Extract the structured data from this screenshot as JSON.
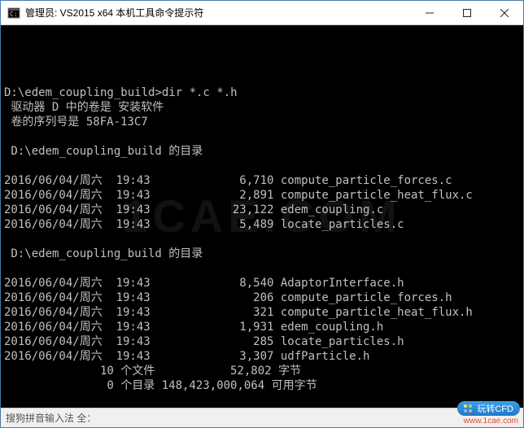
{
  "window": {
    "title": "管理员: VS2015 x64 本机工具命令提示符"
  },
  "terminal": {
    "prompt_path": "D:\\edem_coupling_build>",
    "command": "dir *.c *.h",
    "volume_line": " 驱动器 D 中的卷是 安装软件",
    "serial_line": " 卷的序列号是 58FA-13C7",
    "dir_header": " D:\\edem_coupling_build 的目录",
    "files_c": [
      {
        "date": "2016/06/04/周六",
        "time": "19:43",
        "size": "6,710",
        "name": "compute_particle_forces.c"
      },
      {
        "date": "2016/06/04/周六",
        "time": "19:43",
        "size": "2,891",
        "name": "compute_particle_heat_flux.c"
      },
      {
        "date": "2016/06/04/周六",
        "time": "19:43",
        "size": "23,122",
        "name": "edem_coupling.c"
      },
      {
        "date": "2016/06/04/周六",
        "time": "19:43",
        "size": "5,489",
        "name": "locate_particles.c"
      }
    ],
    "files_h": [
      {
        "date": "2016/06/04/周六",
        "time": "19:43",
        "size": "8,540",
        "name": "AdaptorInterface.h"
      },
      {
        "date": "2016/06/04/周六",
        "time": "19:43",
        "size": "206",
        "name": "compute_particle_forces.h"
      },
      {
        "date": "2016/06/04/周六",
        "time": "19:43",
        "size": "321",
        "name": "compute_particle_heat_flux.h"
      },
      {
        "date": "2016/06/04/周六",
        "time": "19:43",
        "size": "1,931",
        "name": "edem_coupling.h"
      },
      {
        "date": "2016/06/04/周六",
        "time": "19:43",
        "size": "285",
        "name": "locate_particles.h"
      },
      {
        "date": "2016/06/04/周六",
        "time": "19:43",
        "size": "3,307",
        "name": "udfParticle.h"
      }
    ],
    "summary_files_count": "10",
    "summary_files_label": "个文件",
    "summary_files_bytes": "52,802",
    "summary_bytes_label": "字节",
    "summary_dirs_count": "0",
    "summary_dirs_label": "个目录",
    "summary_free": "148,423,000,064",
    "summary_free_label": "可用字节"
  },
  "watermark": "1CAE.COM",
  "ime": {
    "text": "搜狗拼音输入法 全："
  },
  "badge": {
    "text1": "玩转CFD",
    "text2": "www.1cae.com"
  }
}
